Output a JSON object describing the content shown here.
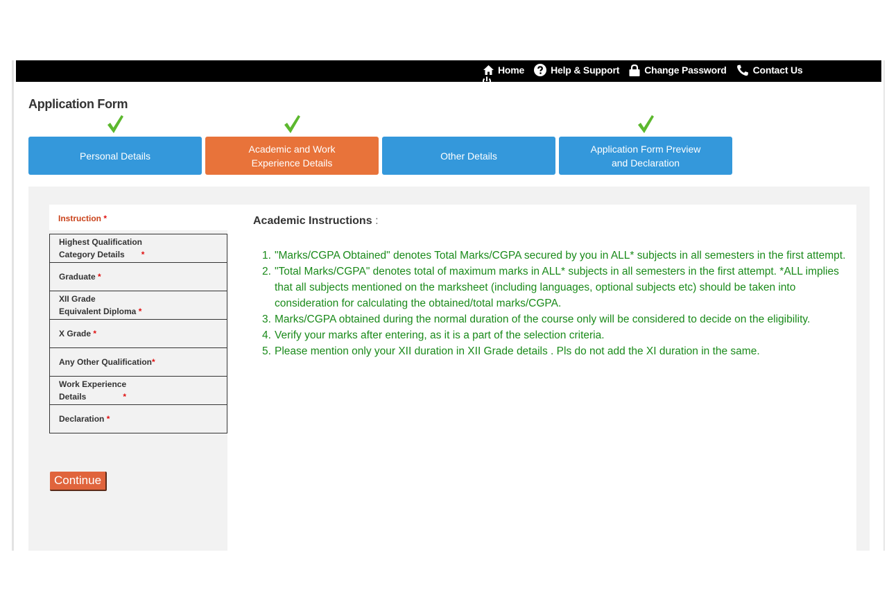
{
  "nav": {
    "items": [
      {
        "label": "Home",
        "icon": "home-icon"
      },
      {
        "label": "Help & Support",
        "icon": "help-icon"
      },
      {
        "label": "Change Password",
        "icon": "lock-icon"
      },
      {
        "label": "Contact Us",
        "icon": "phone-icon"
      }
    ],
    "overflow_icon": "power-icon"
  },
  "page_title": "Application Form",
  "steps": [
    {
      "label": "Personal Details",
      "completed": true,
      "active": false
    },
    {
      "label": "Academic and Work\nExperience Details",
      "completed": true,
      "active": true
    },
    {
      "label": "Other Details",
      "completed": false,
      "active": false
    },
    {
      "label": "Application Form Preview\nand Declaration",
      "completed": true,
      "active": false
    }
  ],
  "sidebar": {
    "instruction": {
      "label": "Instruction",
      "required_mark": "*"
    },
    "items": [
      {
        "line1": "Highest Qualification",
        "line2": "Category Details",
        "required_mark": "*"
      },
      {
        "line1": "Graduate",
        "line2": "",
        "required_mark": "*"
      },
      {
        "line1": "XII Grade",
        "line2": "Equivalent Diploma",
        "required_mark": "*"
      },
      {
        "line1": "X Grade",
        "line2": "",
        "required_mark": "*"
      },
      {
        "line1": "Any Other Qualification",
        "line2": "",
        "required_mark": "*"
      },
      {
        "line1": "Work Experience",
        "line2": "Details",
        "required_mark": "*"
      },
      {
        "line1": "Declaration",
        "line2": "",
        "required_mark": "*"
      }
    ],
    "continue_label": "Continue"
  },
  "instructions": {
    "heading": "Academic Instructions",
    "heading_suffix": ":",
    "items": [
      {
        "num": "1.",
        "text": "\"Marks/CGPA Obtained\" denotes Total Marks/CGPA secured by you in ALL* subjects in all semesters in the first attempt."
      },
      {
        "num": "2.",
        "text": "\"Total Marks/CGPA\" denotes total of maximum marks in ALL* subjects in all semesters in the first attempt. *ALL implies that all subjects mentioned on the marksheet (including languages, optional subjects etc) should be taken into consideration for calculating the obtained/total marks/CGPA."
      },
      {
        "num": "3.",
        "text": "Marks/CGPA obtained during the normal duration of the course only will be considered to decide on the eligibility."
      },
      {
        "num": "4.",
        "text": "Verify your marks after entering, as it is a part of the selection criteria."
      },
      {
        "num": "5.",
        "text": "Please mention only your XII duration in XII Grade details . Pls do not add the XI duration in the same."
      }
    ]
  },
  "colors": {
    "step_blue": "#3498db",
    "step_active_orange": "#e8733a",
    "check_green": "#5cb82e",
    "instruction_green": "#1a8a1a",
    "required_red": "#e01010",
    "continue_button": "#e0643c"
  }
}
